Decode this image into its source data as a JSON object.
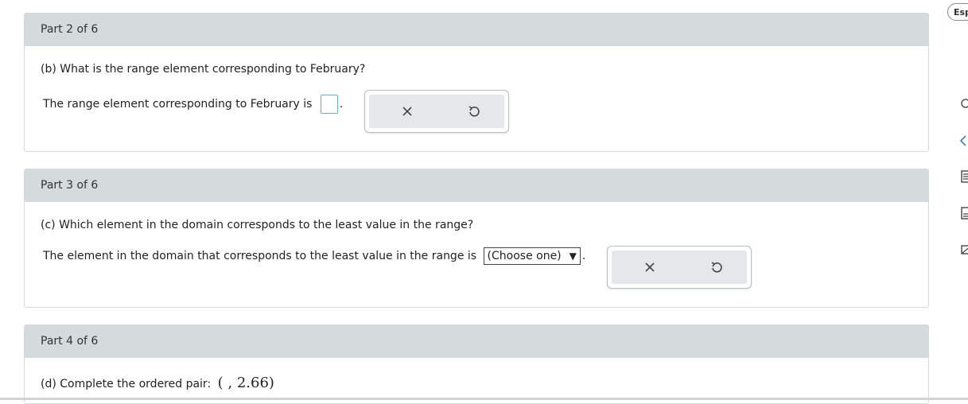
{
  "parts": [
    {
      "header": "Part 2 of 6",
      "question": "(b) What is the range element corresponding to February?",
      "answer_prefix": "The range element corresponding to February is",
      "answer_suffix": "."
    },
    {
      "header": "Part 3 of 6",
      "question": "(c) Which element in the domain corresponds to the least value in the range?",
      "answer_prefix": "The element in the domain that corresponds to the least value in the range is",
      "select_value": "(Choose one)",
      "answer_suffix": "."
    },
    {
      "header": "Part 4 of 6",
      "question": "(d) Complete the ordered pair:",
      "ordered_pair": "( , 2.66)"
    }
  ],
  "tools": {
    "clear_icon": "x-icon",
    "undo_icon": "undo-icon"
  },
  "right_rail": {
    "language_label": "Espa",
    "icons": [
      "lightbulb-icon",
      "eraser-icon",
      "calculator-icon",
      "notebook-icon",
      "mail-icon"
    ]
  },
  "colors": {
    "header_bg": "#d5dadd",
    "tools_bg": "#e4e8ea",
    "answer_border": "#6fa8c8"
  }
}
